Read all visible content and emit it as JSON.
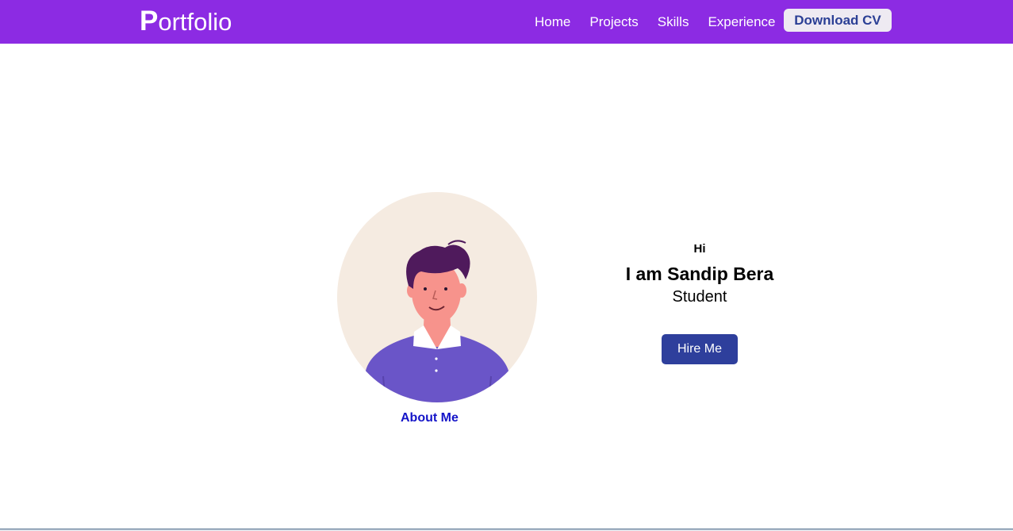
{
  "nav": {
    "brand_first": "P",
    "brand_rest": "ortfolio",
    "links": [
      "Home",
      "Projects",
      "Skills",
      "Experience"
    ],
    "cv_button": "Download CV"
  },
  "hero": {
    "greeting": "Hi",
    "name": "I am Sandip Bera",
    "role": "Student",
    "hire_button": "Hire Me",
    "about_link": "About Me"
  },
  "colors": {
    "nav_bg": "#8c2be3",
    "primary_button": "#2e3f9c",
    "about_link": "#1414c8",
    "avatar_bg": "#f5ebe1",
    "shirt": "#6a55c8",
    "hair": "#4f1a5c",
    "skin": "#f58e88"
  },
  "icons": {
    "avatar": "person-illustration"
  }
}
